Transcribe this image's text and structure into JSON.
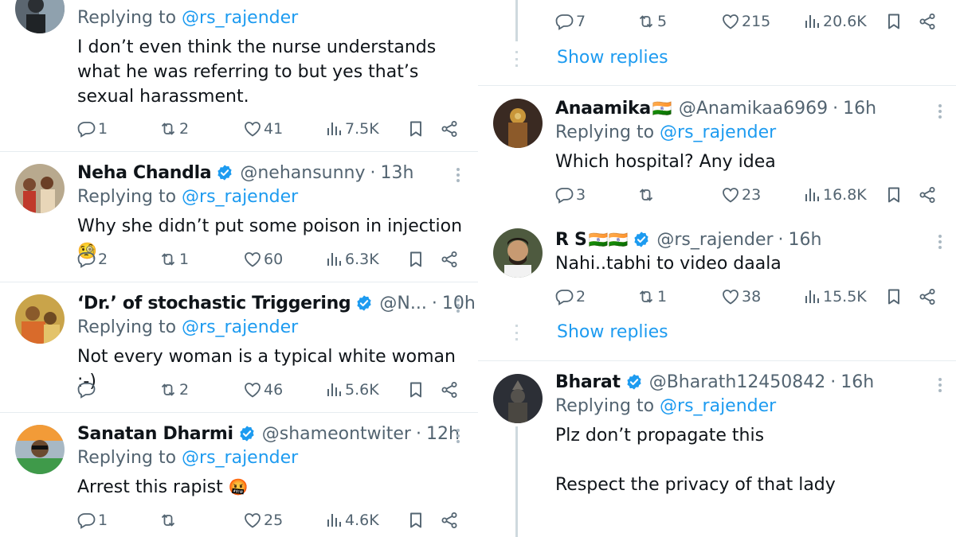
{
  "left": {
    "top_partial": {
      "reply_prefix": "Replying to",
      "reply_handle": "@rs_rajender",
      "text": "I don’t even think the nurse understands what he was referring to but yes that’s sexual harassment.",
      "replies": "1",
      "retweets": "2",
      "likes": "41",
      "views": "7.5K"
    },
    "tweets": [
      {
        "name": "Neha Chandla",
        "handle": "@nehansunny",
        "time": "13h",
        "reply_prefix": "Replying to",
        "reply_handle": "@rs_rajender",
        "text": "Why she didn’t put some poison in injection",
        "emoji": "🧐",
        "replies": "2",
        "retweets": "1",
        "likes": "60",
        "views": "6.3K"
      },
      {
        "name": "‘Dr.’ of stochastic Triggering",
        "handle": "@N...",
        "time": "10h",
        "reply_prefix": "Replying to",
        "reply_handle": "@rs_rajender",
        "text": "Not every woman is a typical white woman :-)",
        "replies": "",
        "retweets": "2",
        "likes": "46",
        "views": "5.6K"
      },
      {
        "name": "Sanatan Dharmi",
        "handle": "@shameontwiter",
        "time": "12h",
        "reply_prefix": "Replying to",
        "reply_handle": "@rs_rajender",
        "text": "Arrest this rapist",
        "emoji": "🤬",
        "replies": "1",
        "retweets": "",
        "likes": "25",
        "views": "4.6K"
      }
    ]
  },
  "right": {
    "top_partial": {
      "replies": "7",
      "retweets": "5",
      "likes": "215",
      "views": "20.6K",
      "show_replies": "Show replies"
    },
    "tweets": [
      {
        "name": "Anaamika",
        "flag": "🇮🇳",
        "handle": "@Anamikaa6969",
        "time": "16h",
        "reply_prefix": "Replying to",
        "reply_handle": "@rs_rajender",
        "text": "Which hospital? Any idea",
        "replies": "3",
        "retweets": "",
        "likes": "23",
        "views": "16.8K"
      },
      {
        "name": "R S",
        "flag": "🇮🇳🇮🇳",
        "handle": "@rs_rajender",
        "time": "16h",
        "text": "Nahi..tabhi to video daala",
        "replies": "2",
        "retweets": "1",
        "likes": "38",
        "views": "15.5K",
        "show_replies": "Show replies"
      },
      {
        "name": "Bharat",
        "handle": "@Bharath12450842",
        "time": "16h",
        "reply_prefix": "Replying to",
        "reply_handle": "@rs_rajender",
        "text": "Plz don’t propagate this\n\nRespect the privacy of that lady"
      }
    ]
  },
  "colors": {
    "accent": "#1d9bf0",
    "muted": "#536471",
    "divider": "#e6ecf0"
  }
}
